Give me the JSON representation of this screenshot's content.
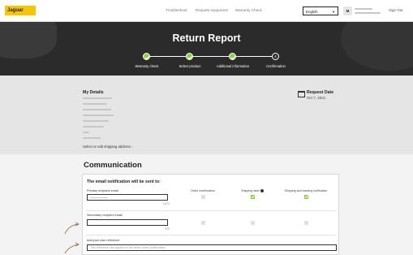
{
  "header": {
    "logo": "Jaguar",
    "nav": [
      "Troubleshoot",
      "Request equipment",
      "Warranty Check"
    ],
    "language": "English",
    "avatar_initial": "M",
    "sign_out": "Sign Out"
  },
  "hero": {
    "title": "Return Report",
    "steps": [
      {
        "label": "Warranty check",
        "state": "done"
      },
      {
        "label": "Select product",
        "state": "done"
      },
      {
        "label": "Additional information",
        "state": "done"
      },
      {
        "label": "Confirmation",
        "state": "current",
        "number": "4"
      }
    ]
  },
  "details": {
    "title": "My Details",
    "edit_link": "Select or edit shipping address ›",
    "request_label": "Request Date",
    "request_date": "Oct 7, 2021"
  },
  "communication": {
    "title": "Communication",
    "card_title": "The email notification will be sent to:",
    "columns": [
      "Order confirmation",
      "Shipping label",
      "Shipping and tracking notification"
    ],
    "primary_label": "Primary recipient email",
    "primary_counter": "14/70",
    "secondary_label": "Secondary recipient email",
    "secondary_counter": "0/70",
    "reference_label": "Add your own reference",
    "reference_placeholder": "This reference can appear on the return order confirmation",
    "rows": [
      {
        "checks": [
          false,
          true,
          true
        ]
      },
      {
        "checks": [
          false,
          false,
          false
        ]
      }
    ]
  },
  "colors": {
    "accent": "#8bd13a",
    "brand": "#f7c600",
    "hero_bg": "#2b2b2b"
  }
}
